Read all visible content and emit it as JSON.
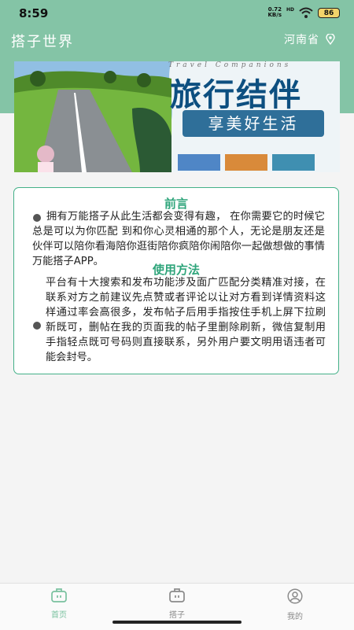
{
  "status_bar": {
    "time": "8:59",
    "net_speed": "0.72",
    "net_unit": "KB/s",
    "network": "HD",
    "battery": "86"
  },
  "header": {
    "title": "搭子世界",
    "location": "河南省"
  },
  "banner": {
    "en_text": "Travel Companions",
    "title": "旅行结伴",
    "subtitle": "享美好生活"
  },
  "intro": {
    "title": "前言",
    "body": "拥有万能搭子从此生活都会变得有趣， 在你需要它的时候它总是可以为你匹配 到和你心灵相通的那个人，无论是朋友还是伙伴可以陪你看海陪你逛街陪你疯陪你闹陪你一起做想做的事情万能搭子APP。"
  },
  "usage": {
    "title": "使用方法",
    "body": "平台有十大搜索和发布功能涉及面广匹配分类精准对接，在联系对方之前建议先点赞或者评论以让对方看到详情资料这样通过率会高很多，发布帖子后用手指按住手机上屏下拉刷新既可，删帖在我的页面我的帖子里删除刷新，微信复制用手指轻点既可号码则直接联系，另外用户要文明用语违者可能会封号。"
  },
  "tabs": [
    {
      "label": "首页",
      "icon": "home-icon",
      "active": true
    },
    {
      "label": "搭子",
      "icon": "partner-icon",
      "active": false
    },
    {
      "label": "我的",
      "icon": "profile-icon",
      "active": false
    }
  ],
  "colors": {
    "header_green": "#84c4a6",
    "accent_green": "#2fa57b",
    "active_tab": "#79c19f",
    "inactive_tab": "#8a8a8a"
  }
}
